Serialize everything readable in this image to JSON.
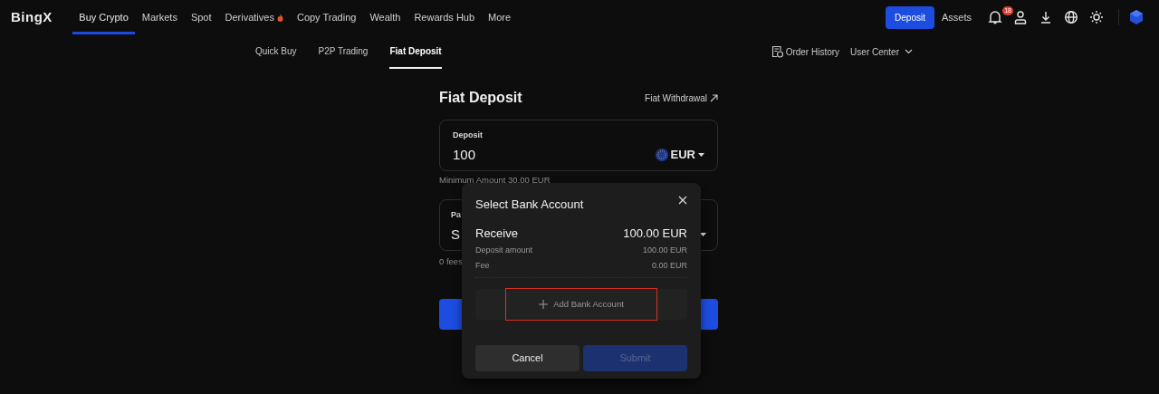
{
  "nav": {
    "logo": "BingX",
    "items": [
      {
        "label": "Buy Crypto",
        "selected": true,
        "hot": false
      },
      {
        "label": "Markets",
        "selected": false,
        "hot": false
      },
      {
        "label": "Spot",
        "selected": false,
        "hot": false
      },
      {
        "label": "Derivatives",
        "selected": false,
        "hot": true
      },
      {
        "label": "Copy Trading",
        "selected": false,
        "hot": false
      },
      {
        "label": "Wealth",
        "selected": false,
        "hot": false
      },
      {
        "label": "Rewards Hub",
        "selected": false,
        "hot": false
      },
      {
        "label": "More",
        "selected": false,
        "hot": false
      }
    ],
    "deposit_button": "Deposit",
    "assets": "Assets",
    "notification_count": "18"
  },
  "subnav": {
    "tabs": [
      {
        "label": "Quick Buy",
        "selected": false
      },
      {
        "label": "P2P Trading",
        "selected": false
      },
      {
        "label": "Fiat Deposit",
        "selected": true
      }
    ],
    "order_history": "Order History",
    "user_center": "User Center"
  },
  "page": {
    "title": "Fiat Deposit",
    "withdrawal_link": "Fiat Withdrawal",
    "deposit": {
      "label": "Deposit",
      "value": "100",
      "currency": "EUR"
    },
    "minimum": "Minimum Amount 30.00 EUR",
    "payment": {
      "label": "Pa",
      "value": "S"
    },
    "fees_note": "0 fees"
  },
  "modal": {
    "title": "Select Bank Account",
    "receive_label": "Receive",
    "receive_value": "100.00 EUR",
    "rows": [
      {
        "label": "Deposit amount",
        "value": "100.00 EUR"
      },
      {
        "label": "Fee",
        "value": "0.00 EUR"
      }
    ],
    "add_bank": "Add Bank Account",
    "add_bank_highlighted": true,
    "cancel": "Cancel",
    "submit": "Submit",
    "submit_disabled": true
  }
}
